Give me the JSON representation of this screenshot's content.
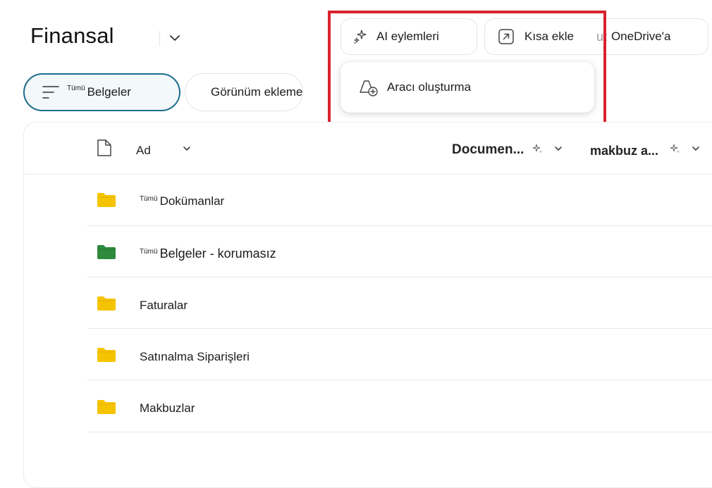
{
  "header": {
    "title": "Finansal",
    "ai_actions_label": "AI eylemleri",
    "shortcut_label": "Kısa ekle",
    "shortcut_suffix_fragment": "ut",
    "onedrive_label": "OneDrive'a"
  },
  "ai_menu": {
    "create_agent_label": "Aracı oluşturma"
  },
  "views": {
    "all_prefix": "Tümü",
    "all_label": "Belgeler",
    "add_view_label": "Görünüm ekleme"
  },
  "columns": {
    "name": "Ad",
    "document_col": "Documen...",
    "receipt_col": "makbuz a..."
  },
  "rows": [
    {
      "prefix": "Tümü",
      "name": "Dokümanlar",
      "folder_color": "#f5c400"
    },
    {
      "prefix": "Tümü",
      "name": "Belgeler - korumasız",
      "folder_color": "#2e8b3e"
    },
    {
      "prefix": "",
      "name": "Faturalar",
      "folder_color": "#f5c400"
    },
    {
      "prefix": "",
      "name": "Satınalma Siparişleri",
      "folder_color": "#f5c400"
    },
    {
      "prefix": "",
      "name": "Makbuzlar",
      "folder_color": "#f5c400"
    }
  ],
  "colors": {
    "highlight_border": "#d9232e",
    "selected_view_border": "#1e6d8c",
    "folder_yellow": "#f5c400",
    "folder_green": "#2e8b3e"
  }
}
